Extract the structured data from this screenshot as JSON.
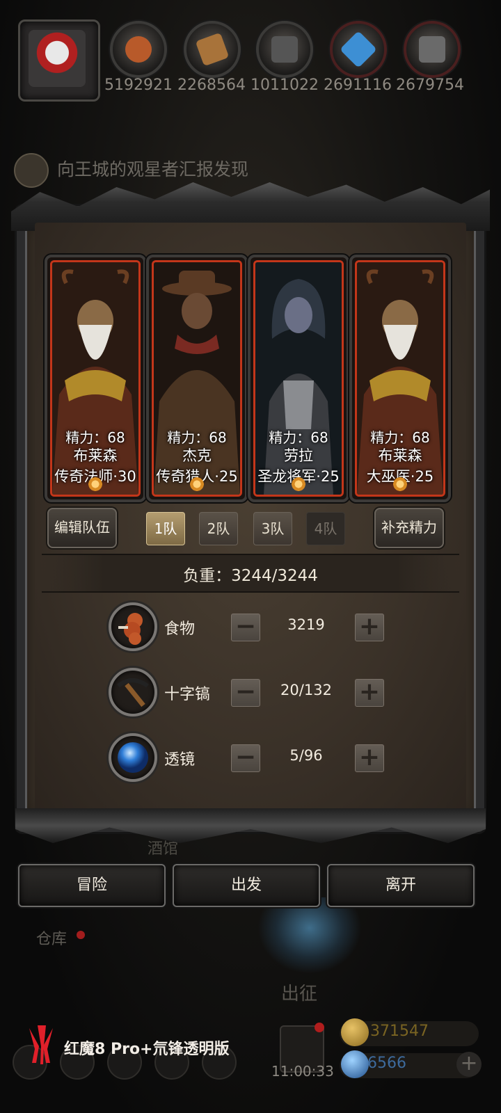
{
  "top_bar": {
    "resources": [
      {
        "icon": "meat-icon",
        "value": "5192921",
        "color": "#b85a2a"
      },
      {
        "icon": "wood-icon",
        "value": "2268564",
        "color": "#b07a3c"
      },
      {
        "icon": "iron-icon",
        "value": "1011022",
        "color": "#6c6c6c"
      },
      {
        "icon": "crystal-icon",
        "value": "2691116",
        "color": "#3d8fd4"
      },
      {
        "icon": "ore-icon",
        "value": "2679754",
        "color": "#707070"
      }
    ]
  },
  "quest": {
    "text": "向王城的观星者汇报发现"
  },
  "dialog": {
    "heroes": [
      {
        "stamina": "精力：68",
        "name": "布莱森",
        "class": "传奇法师·30",
        "skin": "#8a6a46",
        "cloak": "#5a2a1a"
      },
      {
        "stamina": "精力：68",
        "name": "杰克",
        "class": "传奇猎人·25",
        "skin": "#6a4a34",
        "cloak": "#4a3422"
      },
      {
        "stamina": "精力：68",
        "name": "劳拉",
        "class": "圣龙将军·25",
        "skin": "#6a6f86",
        "cloak": "#2e3742"
      },
      {
        "stamina": "精力：68",
        "name": "布莱森",
        "class": "大巫医·25",
        "skin": "#8a6a46",
        "cloak": "#5a2a1a"
      }
    ],
    "edit_team_label": "编辑队伍",
    "teams": [
      {
        "label": "1队",
        "state": "active"
      },
      {
        "label": "2队",
        "state": "normal"
      },
      {
        "label": "3队",
        "state": "normal"
      },
      {
        "label": "4队",
        "state": "disabled"
      }
    ],
    "refill_label": "补充精力",
    "load_text": "负重：3244/3244",
    "items": [
      {
        "label": "食物",
        "value": "3219",
        "icon": "meat-icon"
      },
      {
        "label": "十字镐",
        "value": "20/132",
        "icon": "pickaxe-icon"
      },
      {
        "label": "透镜",
        "value": "5/96",
        "icon": "lens-icon"
      }
    ],
    "minus": "−",
    "plus": "+"
  },
  "actions": {
    "adventure": "冒险",
    "depart": "出发",
    "leave": "离开"
  },
  "background": {
    "tavern": "酒馆",
    "warehouse": "仓库",
    "expedition": "出征",
    "gold": "371547",
    "gems": "6566",
    "clock": "11:00:33",
    "watermark": "红魔8 Pro+氘锋透明版"
  }
}
